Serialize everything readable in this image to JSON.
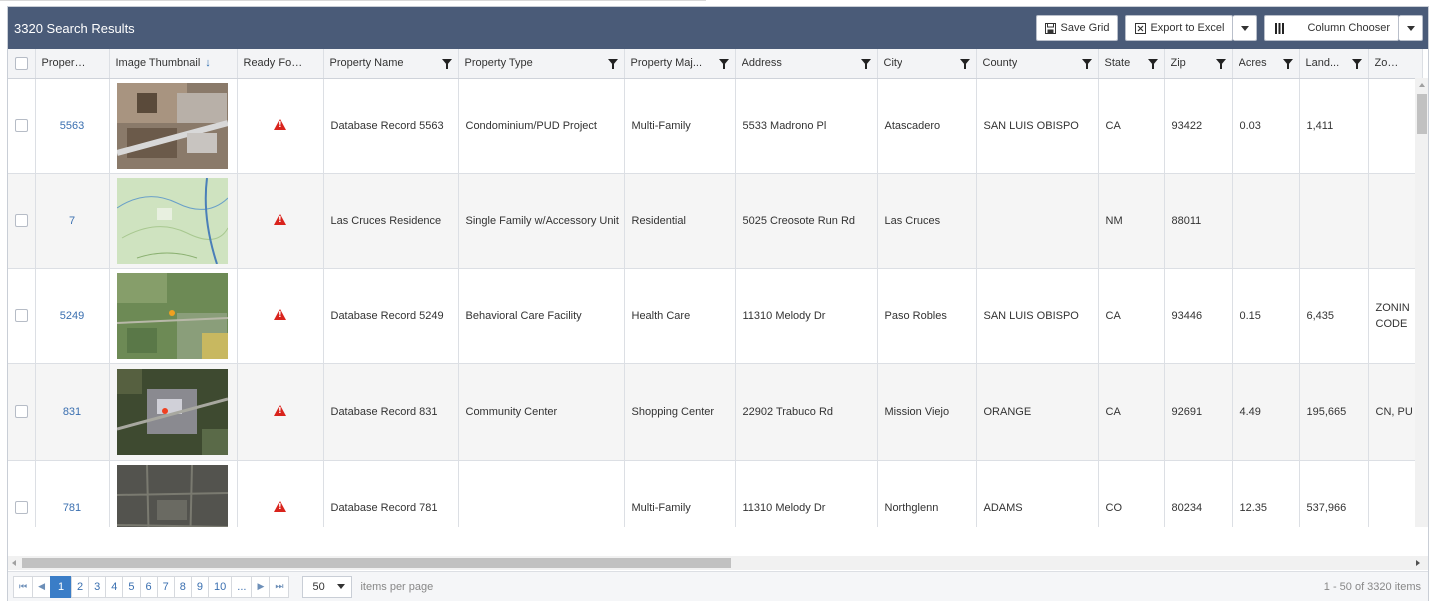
{
  "toolbar": {
    "title": "3320 Search Results",
    "save_label": "Save Grid",
    "export_label": "Export to Excel",
    "column_chooser_label": "Column Chooser"
  },
  "columns": [
    {
      "label": "Property Id",
      "filter": false
    },
    {
      "label": "Image Thumbnail",
      "filter": false,
      "sort": "↓"
    },
    {
      "label": "Ready For Use",
      "filter": false
    },
    {
      "label": "Property Name",
      "filter": true
    },
    {
      "label": "Property Type",
      "filter": true
    },
    {
      "label": "Property Maj...",
      "filter": true
    },
    {
      "label": "Address",
      "filter": true
    },
    {
      "label": "City",
      "filter": true
    },
    {
      "label": "County",
      "filter": true
    },
    {
      "label": "State",
      "filter": true
    },
    {
      "label": "Zip",
      "filter": true
    },
    {
      "label": "Acres",
      "filter": true
    },
    {
      "label": "Land...",
      "filter": true
    },
    {
      "label": "Zoni...",
      "filter": false
    }
  ],
  "rows": [
    {
      "id": "5563",
      "ready_icon": "warning-icon",
      "name": "Database Record 5563",
      "type": "Condominium/PUD Project",
      "major": "Multi-Family",
      "address": "5533 Madrono Pl",
      "city": "Atascadero",
      "county": "SAN LUIS OBISPO",
      "state": "CA",
      "zip": "93422",
      "acres": "0.03",
      "land": "1,411",
      "zoning": ""
    },
    {
      "id": "7",
      "ready_icon": "warning-icon",
      "name": "Las Cruces Residence",
      "type": "Single Family w/Accessory Unit",
      "major": "Residential",
      "address": "5025 Creosote Run Rd",
      "city": "Las Cruces",
      "county": "",
      "state": "NM",
      "zip": "88011",
      "acres": "",
      "land": "",
      "zoning": ""
    },
    {
      "id": "5249",
      "ready_icon": "warning-icon",
      "name": "Database Record 5249",
      "type": "Behavioral Care Facility",
      "major": "Health Care",
      "address": "11310 Melody Dr",
      "city": "Paso Robles",
      "county": "SAN LUIS OBISPO",
      "state": "CA",
      "zip": "93446",
      "acres": "0.15",
      "land": "6,435",
      "zoning": "ZONIN CODE"
    },
    {
      "id": "831",
      "ready_icon": "warning-icon",
      "name": "Database Record 831",
      "type": "Community Center",
      "major": "Shopping Center",
      "address": "22902 Trabuco Rd",
      "city": "Mission Viejo",
      "county": "ORANGE",
      "state": "CA",
      "zip": "92691",
      "acres": "4.49",
      "land": "195,665",
      "zoning": "CN, PU"
    },
    {
      "id": "781",
      "ready_icon": "warning-icon",
      "name": "Database Record 781",
      "type": "",
      "major": "Multi-Family",
      "address": "11310 Melody Dr",
      "city": "Northglenn",
      "county": "ADAMS",
      "state": "CO",
      "zip": "80234",
      "acres": "12.35",
      "land": "537,966",
      "zoning": ""
    }
  ],
  "pager": {
    "first": "⏮",
    "prev": "◀",
    "pages": [
      "1",
      "2",
      "3",
      "4",
      "5",
      "6",
      "7",
      "8",
      "9",
      "10",
      "..."
    ],
    "next": "▶",
    "last": "⏭",
    "page_size": "50",
    "items_per_page": "items per page",
    "range": "1 - 50 of 3320 items"
  },
  "colors": {
    "toolbar_bg": "#4a5b78",
    "link": "#3a6fb0",
    "active_page": "#3a7dc7",
    "warning": "#d9231c"
  }
}
